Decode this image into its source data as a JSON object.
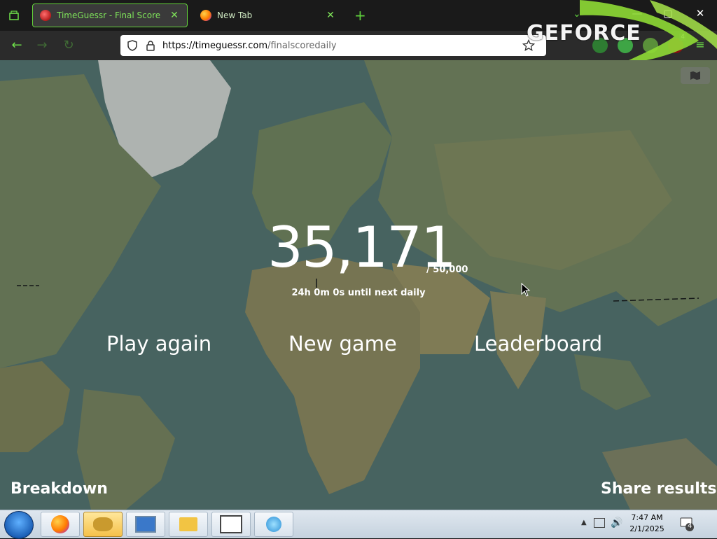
{
  "browser": {
    "tabs": [
      {
        "label": "TimeGuessr - Final Score",
        "active": true
      },
      {
        "label": "New Tab",
        "active": false
      }
    ],
    "url_domain": "https://timeguessr.com",
    "url_path": "/finalscoredaily",
    "overlay_brand": "GEFORCE",
    "extension_badge": "4",
    "colors": {
      "accent": "#63d23a",
      "tab_bg": "#1a1a1a"
    }
  },
  "page": {
    "score": "35,171",
    "score_max": "/ 50,000",
    "next_daily": "24h 0m 0s until next daily",
    "actions": {
      "play_again": "Play again",
      "new_game": "New game",
      "leaderboard": "Leaderboard"
    },
    "breakdown": "Breakdown",
    "share": "Share results"
  },
  "taskbar": {
    "time": "7:47 AM",
    "date": "2/1/2025",
    "notification_count": "4"
  }
}
